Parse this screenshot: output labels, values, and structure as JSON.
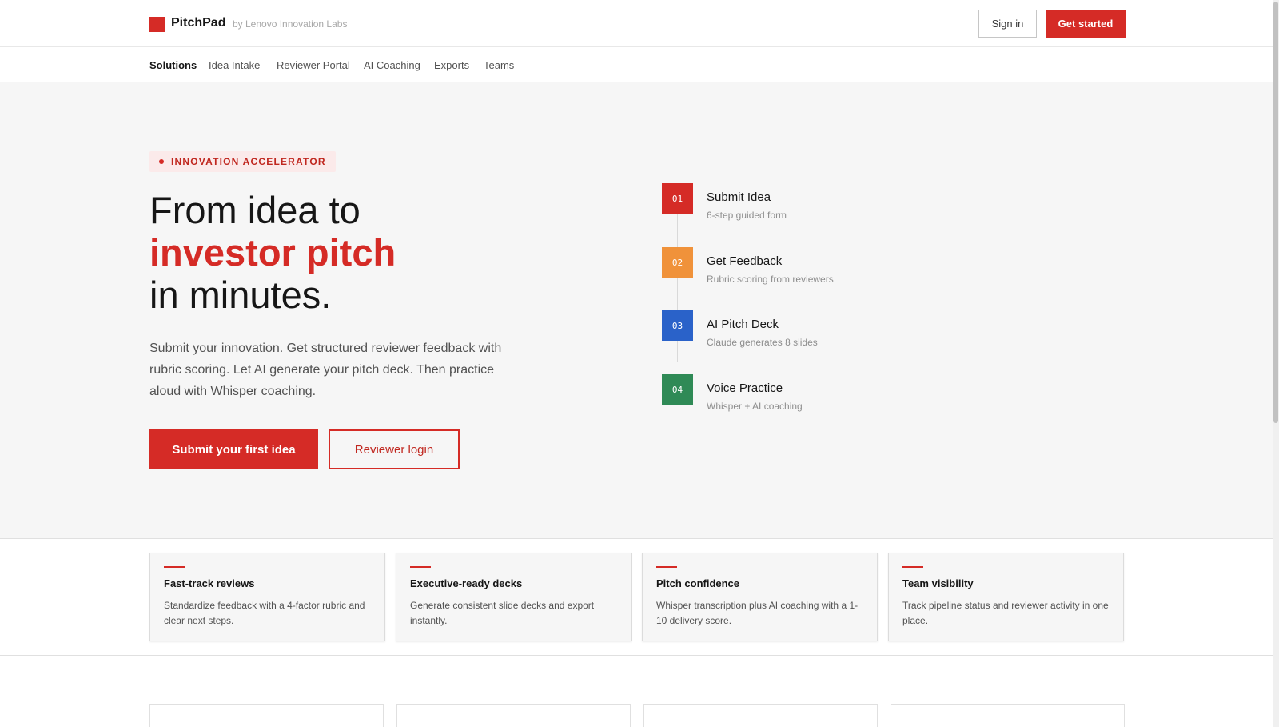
{
  "header": {
    "brand": "PitchPad",
    "brand_sub": "by Lenovo Innovation Labs",
    "signin_label": "Sign in",
    "getstarted_label": "Get started"
  },
  "subnav": [
    "Solutions",
    "Idea Intake",
    "Reviewer Portal",
    "AI Coaching",
    "Exports",
    "Teams"
  ],
  "subnav_active": "Solutions",
  "hero": {
    "pill": "INNOVATION ACCELERATOR",
    "headline_1": "From idea to",
    "headline_2": "investor pitch",
    "headline_3": "in minutes.",
    "lead": "Submit your innovation. Get structured reviewer feedback with rubric scoring. Let AI generate your pitch deck. Then practice aloud with Whisper coaching.",
    "primary_cta": "Submit your first idea",
    "secondary_cta": "Reviewer login"
  },
  "steps": [
    {
      "num": "01",
      "title": "Submit Idea",
      "sub": "6-step guided form",
      "color": "#d52b26"
    },
    {
      "num": "02",
      "title": "Get Feedback",
      "sub": "Rubric scoring from reviewers",
      "color": "#f0923a"
    },
    {
      "num": "03",
      "title": "AI Pitch Deck",
      "sub": "Claude generates 8 slides",
      "color": "#2a62c9"
    },
    {
      "num": "04",
      "title": "Voice Practice",
      "sub": "Whisper + AI coaching",
      "color": "#2f8a56"
    }
  ],
  "features": [
    {
      "title": "Fast-track reviews",
      "desc": "Standardize feedback with a 4-factor rubric and clear next steps."
    },
    {
      "title": "Executive-ready decks",
      "desc": "Generate consistent slide decks and export instantly."
    },
    {
      "title": "Pitch confidence",
      "desc": "Whisper transcription plus AI coaching with a 1-10 delivery score."
    },
    {
      "title": "Team visibility",
      "desc": "Track pipeline status and reviewer activity in one place."
    }
  ],
  "colors": {
    "brand": "#d52b26",
    "hero_bg": "#f6f6f6"
  },
  "icons": {
    "brand_mark": "square-logo-icon",
    "pill_dot": "dot-icon"
  }
}
